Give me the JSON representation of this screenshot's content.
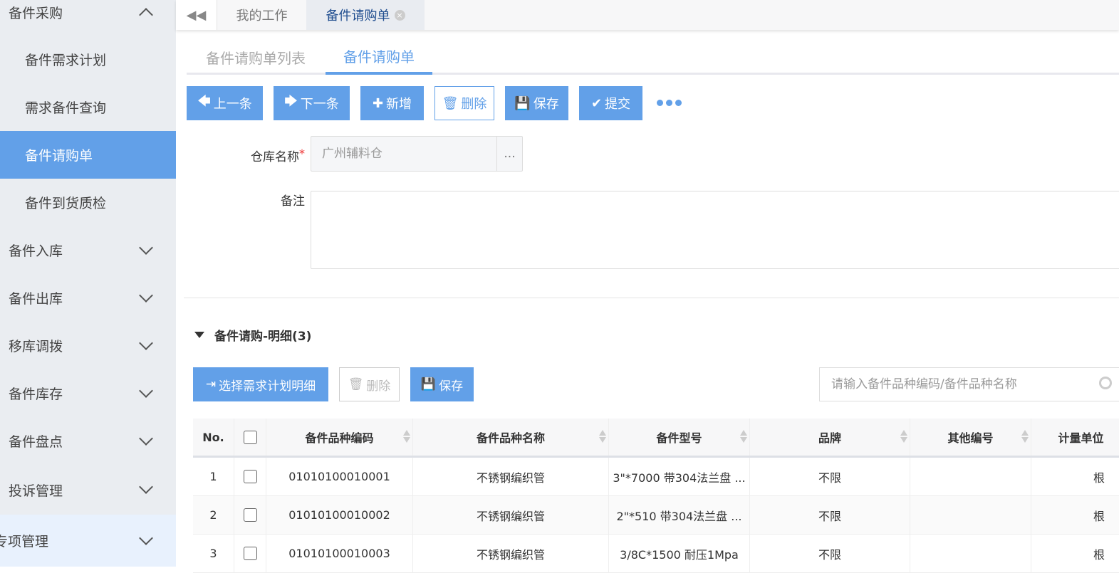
{
  "sidebar": {
    "items": [
      {
        "label": "备件采购",
        "expanded": true
      },
      {
        "label": "备件需求计划",
        "sub": true
      },
      {
        "label": "需求备件查询",
        "sub": true
      },
      {
        "label": "备件请购单",
        "sub": true,
        "active": true
      },
      {
        "label": "备件到货质检",
        "sub": true
      },
      {
        "label": "备件入库"
      },
      {
        "label": "备件出库"
      },
      {
        "label": "移库调拨"
      },
      {
        "label": "备件库存"
      },
      {
        "label": "备件盘点"
      },
      {
        "label": "投诉管理"
      },
      {
        "label": "专项管理"
      }
    ]
  },
  "topbar": {
    "tabs": [
      {
        "label": "我的工作"
      },
      {
        "label": "备件请购单",
        "active": true,
        "close": "×"
      }
    ]
  },
  "subtabs": [
    {
      "label": "备件请购单列表"
    },
    {
      "label": "备件请购单",
      "active": true
    }
  ],
  "toolbar": {
    "prev": "上一条",
    "next": "下一条",
    "add": "新增",
    "delete": "删除",
    "save": "保存",
    "submit": "提交"
  },
  "form": {
    "warehouse_label": "仓库名称",
    "required_mark": "*",
    "warehouse_value": "广州辅料仓",
    "ellipsis": "...",
    "remark_label": "备注",
    "remark_value": ""
  },
  "detail": {
    "title": "备件请购-明细(3)",
    "select_btn": "选择需求计划明细",
    "delete_btn": "删除",
    "save_btn": "保存",
    "search_placeholder": "请输入备件品种编码/备件品种名称"
  },
  "table": {
    "headers": [
      "No.",
      "",
      "备件品种编码",
      "备件品种名称",
      "备件型号",
      "品牌",
      "其他编号",
      "计量单位"
    ],
    "rows": [
      [
        "1",
        "",
        "01010100010001",
        "不锈钢编织管",
        "3\"*7000 带304法兰盘 ...",
        "不限",
        "",
        "根"
      ],
      [
        "2",
        "",
        "01010100010002",
        "不锈钢编织管",
        "2\"*510 带304法兰盘 ...",
        "不限",
        "",
        "根"
      ],
      [
        "3",
        "",
        "01010100010003",
        "不锈钢编织管",
        "3/8C*1500 耐压1Mpa",
        "不限",
        "",
        "根"
      ]
    ]
  },
  "colors": {
    "accent": "#62a0e8",
    "sidebar_bg": "#eaedf1"
  }
}
